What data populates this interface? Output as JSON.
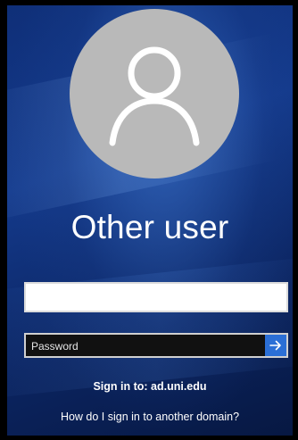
{
  "login": {
    "user_name": "Other user",
    "username_value": "",
    "password_placeholder": "Password",
    "sign_in_to": "Sign in to: ad.uni.edu",
    "domain_help_link": "How do I sign in to another domain?"
  },
  "icons": {
    "avatar": "user-silhouette-icon",
    "submit": "arrow-right-icon"
  },
  "colors": {
    "background": "#143a8c",
    "avatar_circle": "#b9b9b9",
    "submit_button": "#2b6fd6",
    "text": "#ffffff"
  }
}
